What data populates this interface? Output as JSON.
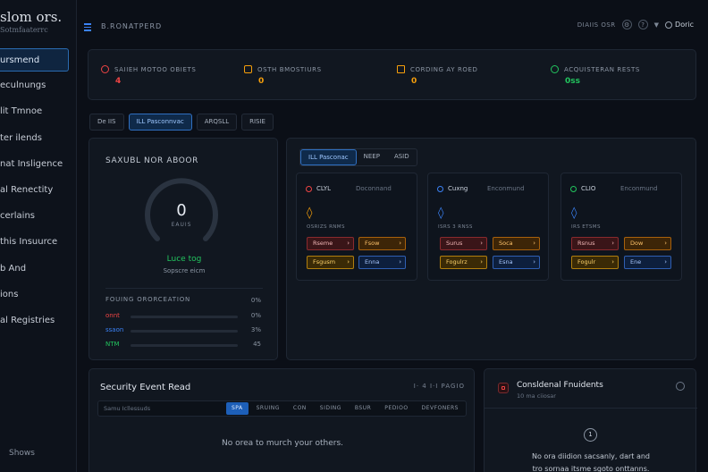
{
  "brand": {
    "title": "slom ors.",
    "subtitle": "Sotmfaaterrc"
  },
  "sidebar": {
    "items": [
      {
        "label": "ursmend",
        "active": true
      },
      {
        "label": "eculnungs"
      },
      {
        "label": "lit Tmnoe"
      },
      {
        "label": "ter ilends"
      },
      {
        "label": "nat Insligence"
      },
      {
        "label": "al Renectity"
      },
      {
        "label": "cerlains"
      },
      {
        "label": "this Insuurce"
      },
      {
        "label": "b And"
      },
      {
        "label": "ions"
      },
      {
        "label": "al Registries"
      }
    ],
    "footer": "Shows"
  },
  "topbar": {
    "breadcrumb": "B.RONATPERD",
    "right_text": "DIAIIS OSR",
    "user": "Doric"
  },
  "stats": [
    {
      "label": "SAIIEH MOTOO OBIETS",
      "value": "4",
      "color": "#ef4444",
      "icon": "alert-circle-icon"
    },
    {
      "label": "OSTH BMOSTIURS",
      "value": "0",
      "color": "#f59e0b",
      "icon": "link-icon"
    },
    {
      "label": "CORDING AY ROED",
      "value": "0",
      "color": "#f59e0b",
      "icon": "grid-icon"
    },
    {
      "label": "ACQUISTERAN RESTS",
      "value": "0ss",
      "color": "#22c55e",
      "icon": "check-circle-icon"
    }
  ],
  "filter_tabs": [
    {
      "label": "De IIS"
    },
    {
      "label": "ILL Pasconnvac",
      "active": true
    },
    {
      "label": "ARQSLL"
    },
    {
      "label": "RISIE"
    }
  ],
  "gauge": {
    "title": "SAXUBL NOR ABOOR",
    "value": "0",
    "sub": "EAUIS",
    "level": 0.0,
    "status": "Luce tog",
    "status_sub": "Sopscre eicm",
    "metrics_title": "FOUING ORORCEATION",
    "metrics_pct": "0%",
    "metrics": [
      {
        "label": "onnt",
        "pct": "0%",
        "color": "#ef4444",
        "level": 0.0
      },
      {
        "label": "ssaon",
        "pct": "3%",
        "color": "#3b82f6",
        "level": 0.03
      },
      {
        "label": "NTM",
        "pct": "45",
        "color": "#22c55e",
        "level": 0.0
      }
    ]
  },
  "modules": {
    "tabs": [
      {
        "label": "ILL Pasconac",
        "active": true
      },
      {
        "label": "NEEP"
      },
      {
        "label": "ASID"
      }
    ],
    "cards": [
      {
        "name": "CLYL",
        "status": "Doconnand",
        "color": "#ef4444",
        "glyph": "◊",
        "glyph_color": "#f59e0b",
        "sub": "OSRIZS RNMS",
        "buttons": [
          {
            "label": "Rseme",
            "style": "red"
          },
          {
            "label": "Fsow",
            "style": "orange"
          },
          {
            "label": "Fsgusm",
            "style": "yellow"
          },
          {
            "label": "Enna",
            "style": "blue"
          }
        ]
      },
      {
        "name": "Cuxng",
        "status": "Enconmund",
        "color": "#3b82f6",
        "glyph": "◊",
        "glyph_color": "#3b82f6",
        "sub": "ISRS 3 RNSS",
        "buttons": [
          {
            "label": "Surus",
            "style": "red"
          },
          {
            "label": "Soca",
            "style": "orange"
          },
          {
            "label": "Fogulrz",
            "style": "yellow"
          },
          {
            "label": "Esna",
            "style": "blue"
          }
        ]
      },
      {
        "name": "CLIO",
        "status": "Enconmund",
        "color": "#22c55e",
        "glyph": "◊",
        "glyph_color": "#3b82f6",
        "sub": "IRS ETSMS",
        "buttons": [
          {
            "label": "Rsnus",
            "style": "red"
          },
          {
            "label": "Dow",
            "style": "orange"
          },
          {
            "label": "Fogulr",
            "style": "yellow"
          },
          {
            "label": "Ene",
            "style": "blue"
          }
        ]
      }
    ]
  },
  "events": {
    "title": "Security Event Read",
    "right": "I·  4  I·I   PAGIO",
    "search_placeholder": "Samu Icllessuds",
    "chips": [
      {
        "label": "SPA",
        "active": true
      },
      {
        "label": "SRUING"
      },
      {
        "label": "CON"
      },
      {
        "label": "SIDING"
      },
      {
        "label": "BSUR"
      },
      {
        "label": "PEDIOO"
      },
      {
        "label": "DEVFONERS"
      }
    ],
    "empty": "No orea to murch your others."
  },
  "incidents": {
    "title": "Consldenal Fnuidents",
    "subtitle": "10 ma ciiosar",
    "count": "1",
    "empty_line1": "No ora diidion sacsanly, dart and",
    "empty_line2": "tro sornaa itsme sgoto onttanns."
  }
}
